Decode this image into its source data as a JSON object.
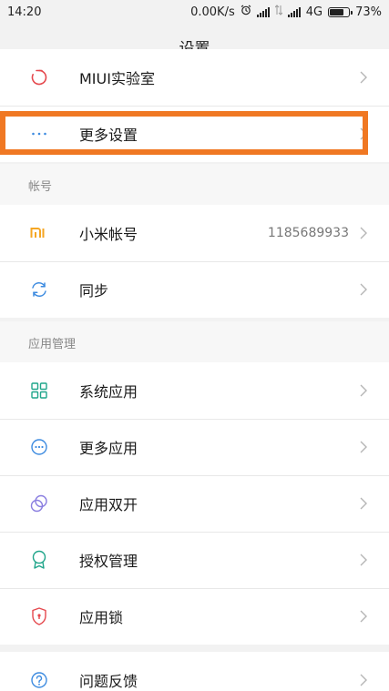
{
  "status_bar": {
    "time": "14:20",
    "speed": "0.00K/s",
    "network": "4G",
    "battery": "73%",
    "battery_level": 0.73
  },
  "header": {
    "title": "设置"
  },
  "top_group": {
    "items": [
      {
        "label": "MIUI实验室",
        "icon": "flask-circle-icon"
      },
      {
        "label": "更多设置",
        "icon": "more-dots-icon"
      }
    ]
  },
  "account_section": {
    "header": "帐号",
    "items": [
      {
        "label": "小米帐号",
        "value": "1185689933",
        "icon": "mi-logo-icon"
      },
      {
        "label": "同步",
        "icon": "sync-icon"
      }
    ]
  },
  "apps_section": {
    "header": "应用管理",
    "items": [
      {
        "label": "系统应用",
        "icon": "grid-apps-icon"
      },
      {
        "label": "更多应用",
        "icon": "more-apps-icon"
      },
      {
        "label": "应用双开",
        "icon": "dual-apps-icon"
      },
      {
        "label": "授权管理",
        "icon": "badge-icon"
      },
      {
        "label": "应用锁",
        "icon": "shield-lock-icon"
      }
    ]
  },
  "help_group": {
    "items": [
      {
        "label": "问题反馈",
        "icon": "help-icon"
      }
    ]
  },
  "colors": {
    "highlight": "#f07823",
    "mi_orange": "#f5a623",
    "blue": "#3d8be0",
    "teal": "#1fa58a",
    "purple": "#8a7ee0",
    "red": "#e5484d"
  }
}
